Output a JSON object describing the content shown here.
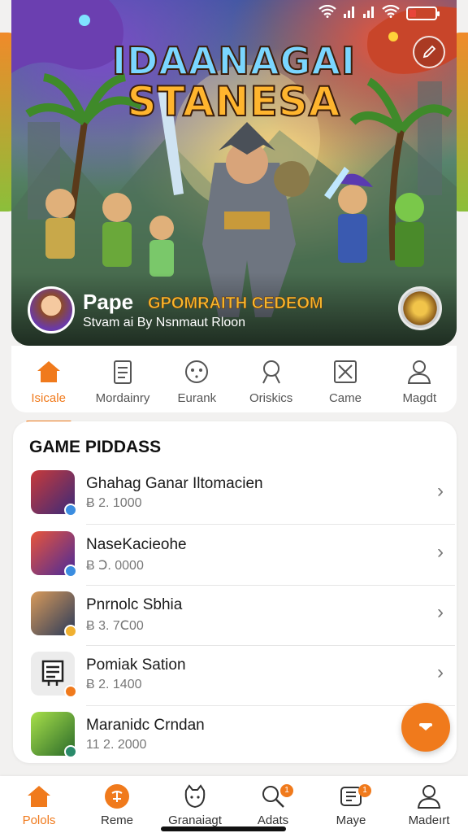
{
  "status_bar": {
    "icons": [
      "wifi-icon",
      "signal-icon",
      "signal-icon",
      "wifi-icon",
      "battery-icon"
    ]
  },
  "hero": {
    "title_line1": "IDAANAGAI",
    "title_line2": "STANESA",
    "creator_name": "Pape",
    "game_name": "GPOMRAITH CEDEOM",
    "subtitle": "Stvam ai By Nsnmaut Rloon",
    "edit_icon": "pencil-icon",
    "emblem_icon": "dragon-emblem-icon"
  },
  "category_tabs": [
    {
      "label": "Isicale",
      "icon": "home-icon",
      "active": true
    },
    {
      "label": "Mordainry",
      "icon": "document-icon",
      "active": false
    },
    {
      "label": "Eurank",
      "icon": "face-icon",
      "active": false
    },
    {
      "label": "Oriskics",
      "icon": "search-icon",
      "active": false
    },
    {
      "label": "Came",
      "icon": "box-x-icon",
      "active": false
    },
    {
      "label": "Magdt",
      "icon": "person-icon",
      "active": false
    }
  ],
  "game_list": {
    "title": "GAME PIDDASS",
    "items": [
      {
        "name": "Ghahag Ganar Iltomacien",
        "price": "Ƀ 2. 1000",
        "thumb_color": "#7a2a4a"
      },
      {
        "name": "NaseKacieohe",
        "price": "Ƀ Ↄ. 0000",
        "thumb_color": "#4a2a7a"
      },
      {
        "name": "Pnrnolc Sbhia",
        "price": "Ƀ 3. 7Ⅽ00",
        "thumb_color": "#2a4a6a"
      },
      {
        "name": "Pomiak Sation",
        "price": "Ƀ 2. 1400",
        "thumb_color": "#e9e9e9"
      },
      {
        "name": "Maranidc Crndan",
        "price": "11 2. 2000",
        "thumb_color": "#3a8a2a"
      }
    ]
  },
  "fab": {
    "icon": "chevron-down-icon"
  },
  "bottom_nav": [
    {
      "label": "Polols",
      "icon": "home-icon",
      "active": true,
      "badge": ""
    },
    {
      "label": "Reme",
      "icon": "tag-icon",
      "active": false,
      "badge": ""
    },
    {
      "label": "Granaiagt",
      "icon": "face-icon",
      "active": false,
      "badge": ""
    },
    {
      "label": "Adats",
      "icon": "search-icon",
      "active": false,
      "badge": "1"
    },
    {
      "label": "Maye",
      "icon": "cart-icon",
      "active": false,
      "badge": "1"
    },
    {
      "label": "Madeırt",
      "icon": "person-icon",
      "active": false,
      "badge": ""
    }
  ],
  "colors": {
    "accent": "#f07a1c",
    "background": "#f2f1f0",
    "card": "#ffffff"
  }
}
